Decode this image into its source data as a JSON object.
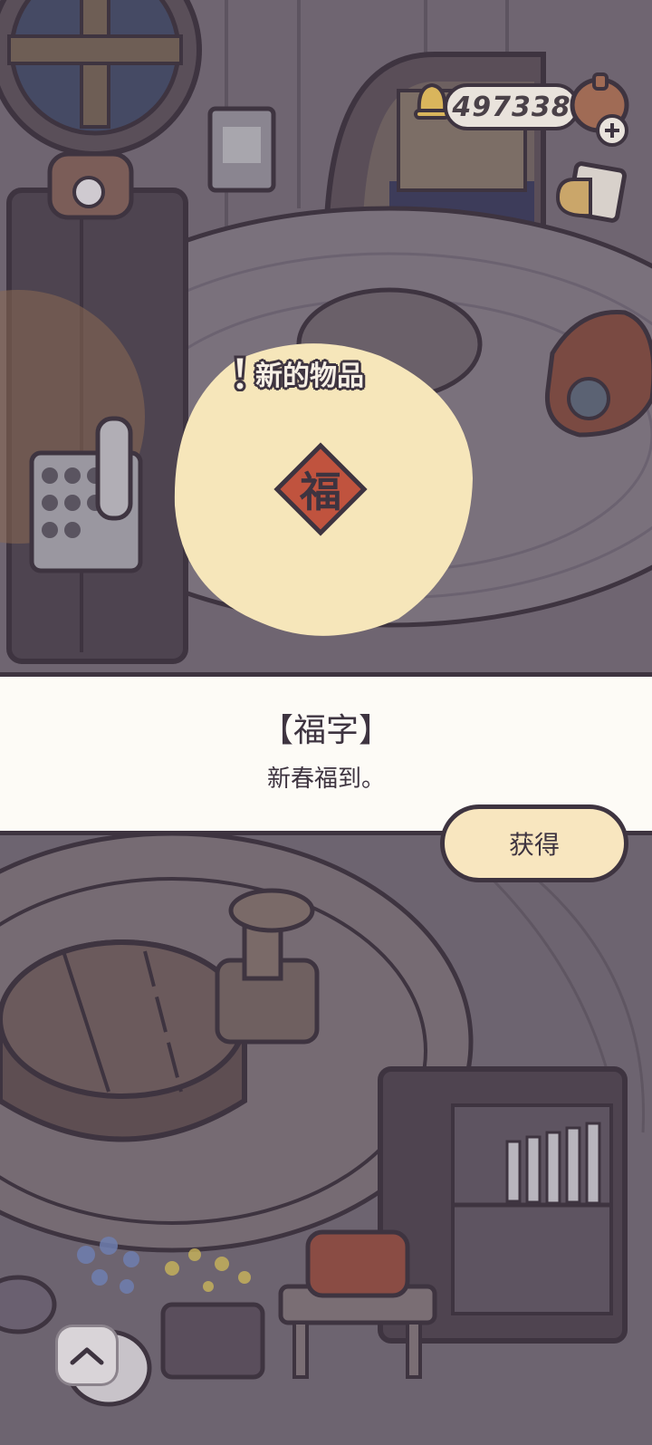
{
  "hud": {
    "coin_count": "497338"
  },
  "reward": {
    "badge_text": "新的物品",
    "item_emblem": "福",
    "item_name": "【福字】",
    "item_description": "新春福到。",
    "get_label": "获得"
  },
  "colors": {
    "outline": "#3e3440",
    "panel_bg": "#fdfbf6",
    "highlight_blob": "#f6e6ba",
    "button_fill": "#f8e6bf",
    "emblem_red": "#c0533e"
  },
  "icons": {
    "coin": "bell-coin-icon",
    "add": "plus-icon",
    "mail": "mail-icon",
    "item": "fu-diamond-icon",
    "expand": "chevron-up-icon"
  }
}
